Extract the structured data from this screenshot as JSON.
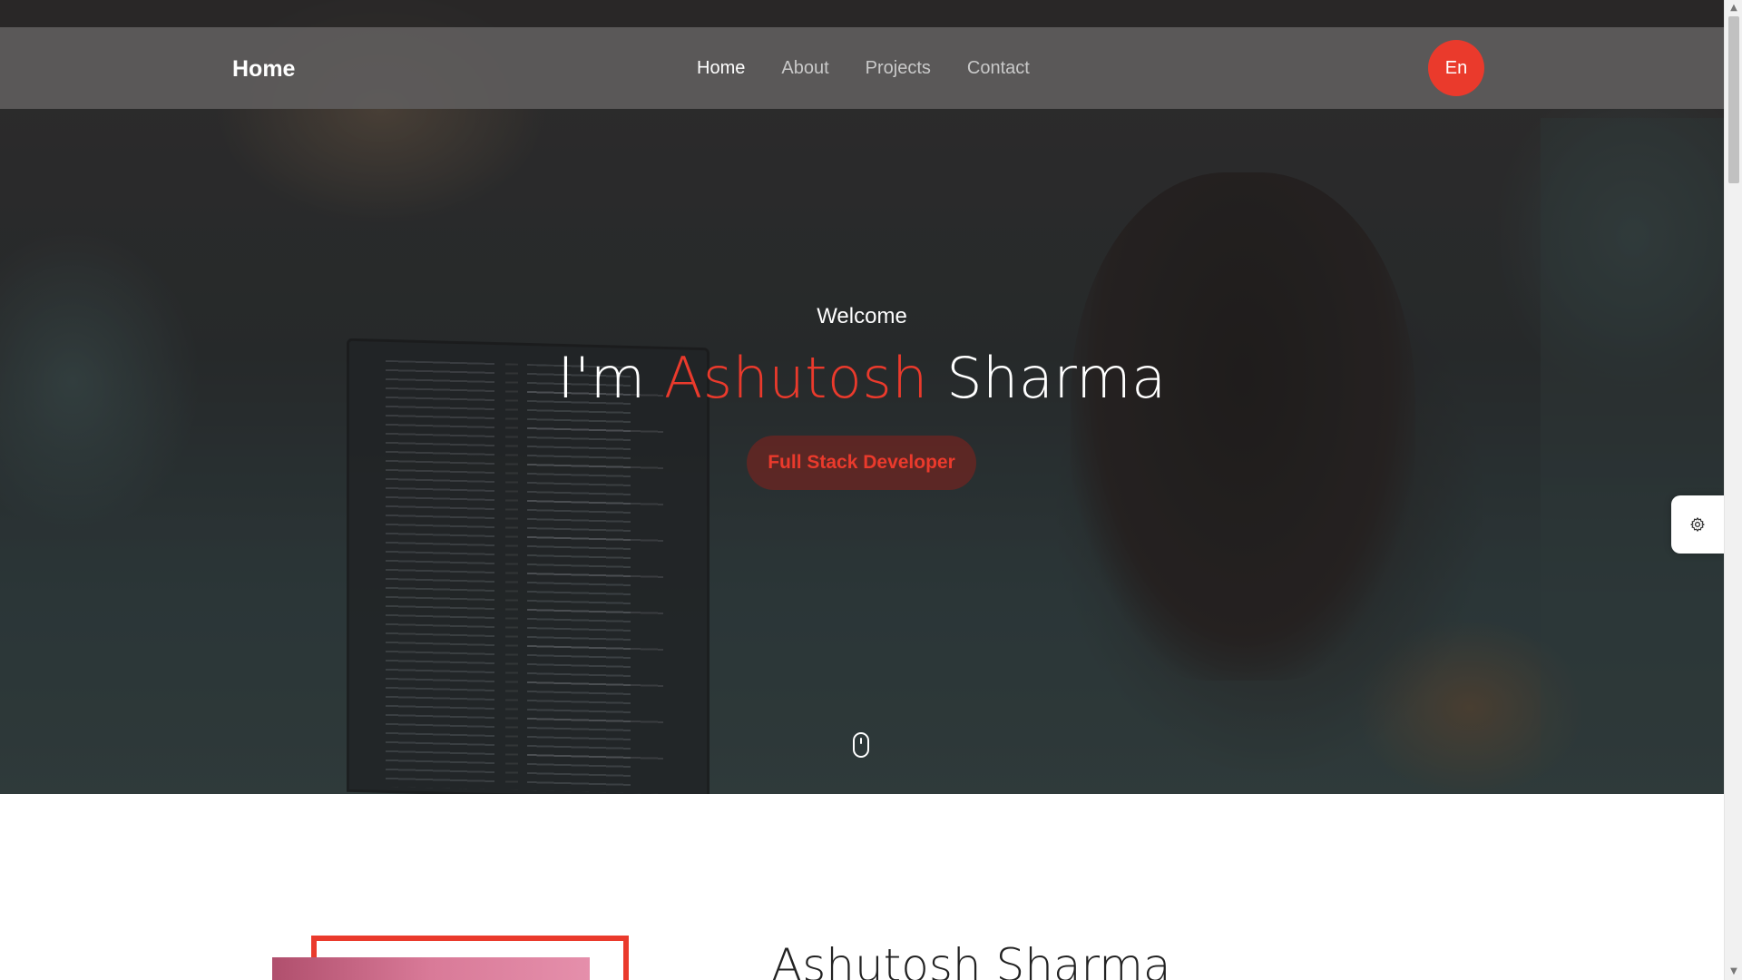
{
  "navbar": {
    "brand": "Home",
    "links": [
      {
        "label": "Home",
        "active": true
      },
      {
        "label": "About",
        "active": false
      },
      {
        "label": "Projects",
        "active": false
      },
      {
        "label": "Contact",
        "active": false
      }
    ],
    "language_button": "En"
  },
  "hero": {
    "welcome": "Welcome",
    "title_prefix": "I'm",
    "first_name": "Ashutosh",
    "last_name": "Sharma",
    "role_button": "Full Stack Developer",
    "scroll_indicator_icon": "mouse-icon"
  },
  "settings": {
    "icon": "gear-icon"
  },
  "about": {
    "name": "Ashutosh Sharma"
  },
  "colors": {
    "accent": "#ea3a2c",
    "navbar": "#5f5d5d",
    "text_light": "#ffffff"
  }
}
